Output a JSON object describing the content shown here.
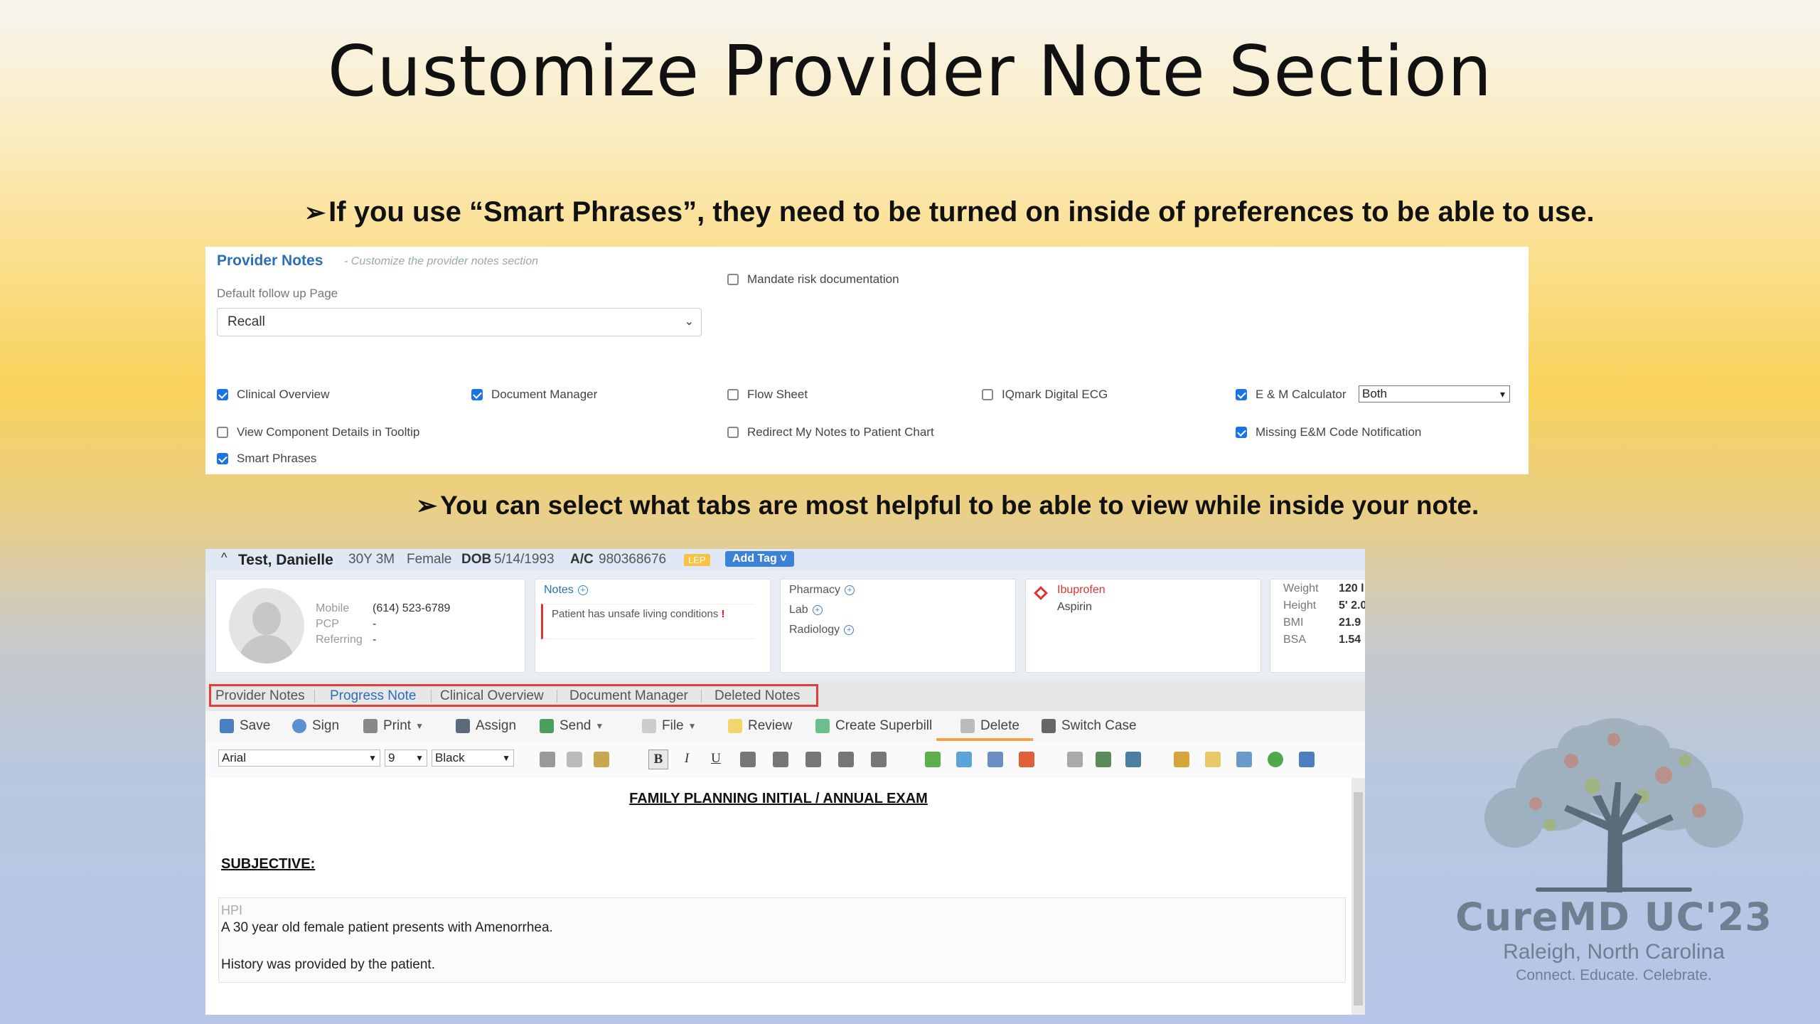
{
  "slide": {
    "title": "Customize Provider Note Section",
    "bullet1": "If you use “Smart Phrases”, they need to be turned on inside of preferences to be able to use.",
    "bullet2": "You can select what tabs are most helpful to be able to view while inside your note.",
    "arrow": "➢"
  },
  "prefs": {
    "header": "Provider Notes",
    "subtitle": "- Customize the provider notes section",
    "follow_label": "Default follow up Page",
    "follow_value": "Recall",
    "mandate": {
      "label": "Mandate risk documentation",
      "checked": false
    },
    "em_select_value": "Both",
    "checkboxes": [
      {
        "label": "Clinical Overview",
        "checked": true
      },
      {
        "label": "Document Manager",
        "checked": true
      },
      {
        "label": "Flow Sheet",
        "checked": false
      },
      {
        "label": "IQmark Digital ECG",
        "checked": false
      },
      {
        "label": "E & M Calculator",
        "checked": true
      },
      {
        "label": "View Component Details in Tooltip",
        "checked": false
      },
      {
        "label": "Redirect My Notes to Patient Chart",
        "checked": false
      },
      {
        "label": "Missing E&M Code Notification",
        "checked": true
      },
      {
        "label": "Smart Phrases",
        "checked": true
      }
    ]
  },
  "patient": {
    "caret": "^",
    "name": "Test, Danielle",
    "age": "30Y 3M",
    "sex": "Female",
    "dob_label": "DOB",
    "dob": "5/14/1993",
    "ac_label": "A/C",
    "ac": "980368676",
    "lep": "LEP",
    "add_tag": "Add Tag",
    "mobile_label": "Mobile",
    "mobile": "(614) 523-6789",
    "pcp_label": "PCP",
    "pcp": "-",
    "referring_label": "Referring",
    "referring": "-",
    "notes_label": "Notes",
    "note_text": "Patient has unsafe living conditions",
    "pharmacy": "Pharmacy",
    "lab": "Lab",
    "radiology": "Radiology",
    "allergy1": "Ibuprofen",
    "allergy2": "Aspirin",
    "vitals": [
      {
        "k": "Weight",
        "v": "120 l"
      },
      {
        "k": "Height",
        "v": "5' 2.0"
      },
      {
        "k": "BMI",
        "v": "21.9"
      },
      {
        "k": "BSA",
        "v": "1.54"
      }
    ]
  },
  "tabs": [
    "Provider Notes",
    "Progress Note",
    "Clinical Overview",
    "Document Manager",
    "Deleted Notes"
  ],
  "toolbar": {
    "save": "Save",
    "sign": "Sign",
    "print": "Print",
    "assign": "Assign",
    "send": "Send",
    "file": "File",
    "review": "Review",
    "superbill": "Create Superbill",
    "delete": "Delete",
    "switch": "Switch Case"
  },
  "format": {
    "font": "Arial",
    "size": "9",
    "color": "Black",
    "bold": "B",
    "italic": "I",
    "underline": "U"
  },
  "editor": {
    "title": "FAMILY PLANNING INITIAL / ANNUAL EXAM",
    "subjective": "SUBJECTIVE:",
    "hpi_label": "HPI",
    "hpi_line1": "A 30 year old female patient presents with Amenorrhea.",
    "hpi_line2": "History was provided by the patient."
  },
  "logo": {
    "line1": "CureMD UC'23",
    "line2": "Raleigh, North Carolina",
    "line3": "Connect. Educate. Celebrate."
  }
}
